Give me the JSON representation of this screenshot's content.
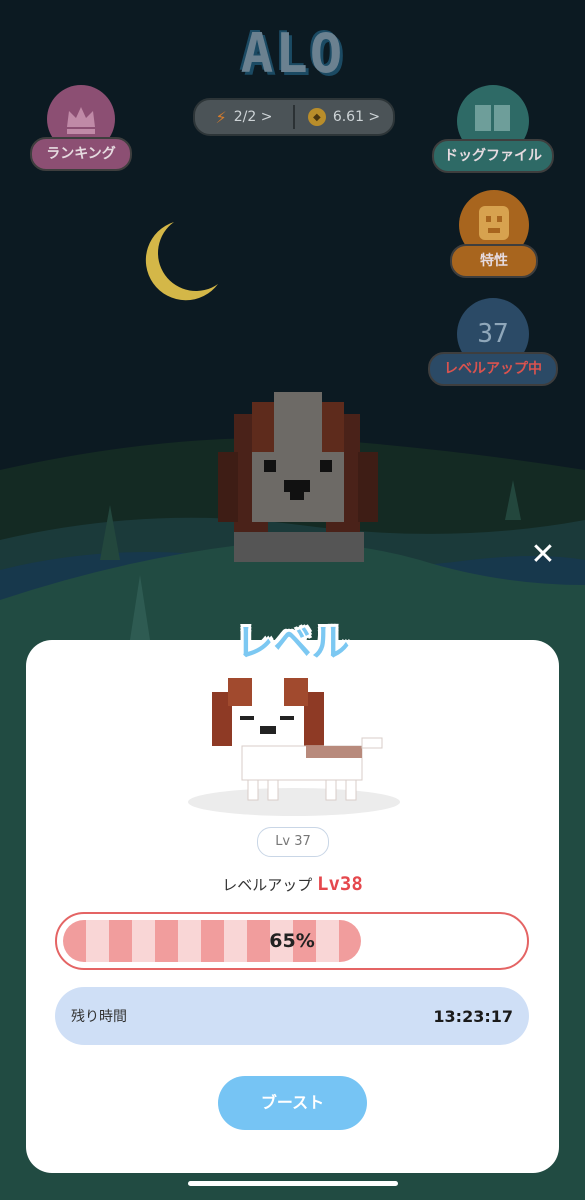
{
  "app": {
    "title": "ALO"
  },
  "status": {
    "energy": "2/2 >",
    "coins": "6.61 >"
  },
  "side_buttons": {
    "ranking": "ランキング",
    "dog_file": "ドッグファイル",
    "traits": "特性",
    "level_number": "37",
    "leveling": "レベルアップ中"
  },
  "modal": {
    "title": "レベル",
    "current_level": "Lv 37",
    "levelup_label": "レベルアップ",
    "next_level": "Lv38",
    "progress_text": "65%",
    "progress_value": 0.65,
    "remaining_label": "残り時間",
    "remaining_time": "13:23:17",
    "boost_label": "ブースト"
  },
  "colors": {
    "night_sky": "#0c1a22",
    "accent_blue": "#76c4f4",
    "progress_red": "#e46464",
    "level_red": "#e5484d"
  }
}
